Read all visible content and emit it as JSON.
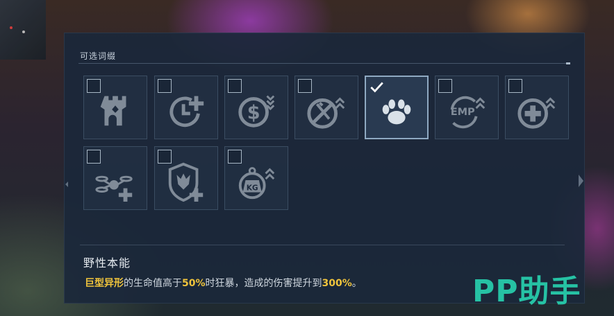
{
  "panel": {
    "title": "可选词缀"
  },
  "affixes": [
    {
      "name": "fortress-icon",
      "checked": false
    },
    {
      "name": "clock-plus-icon",
      "checked": false
    },
    {
      "name": "coin-down-icon",
      "checked": false
    },
    {
      "name": "no-melee-up-icon",
      "checked": false
    },
    {
      "name": "paw-icon",
      "checked": true
    },
    {
      "name": "emp-up-icon",
      "checked": false
    },
    {
      "name": "heal-up-icon",
      "checked": false
    },
    {
      "name": "drone-plus-icon",
      "checked": false
    },
    {
      "name": "monster-shield-plus-icon",
      "checked": false
    },
    {
      "name": "weight-up-icon",
      "checked": false
    }
  ],
  "detail": {
    "name": "野性本能",
    "desc_parts": [
      "巨型异形",
      "的生命值高于",
      "50%",
      "时狂暴，造成的伤害提升到",
      "300%",
      "。"
    ]
  },
  "watermark": "PP助手",
  "colors": {
    "highlight": "#f0c43c",
    "panel": "#1b283a",
    "watermark": "#26c2a4"
  }
}
